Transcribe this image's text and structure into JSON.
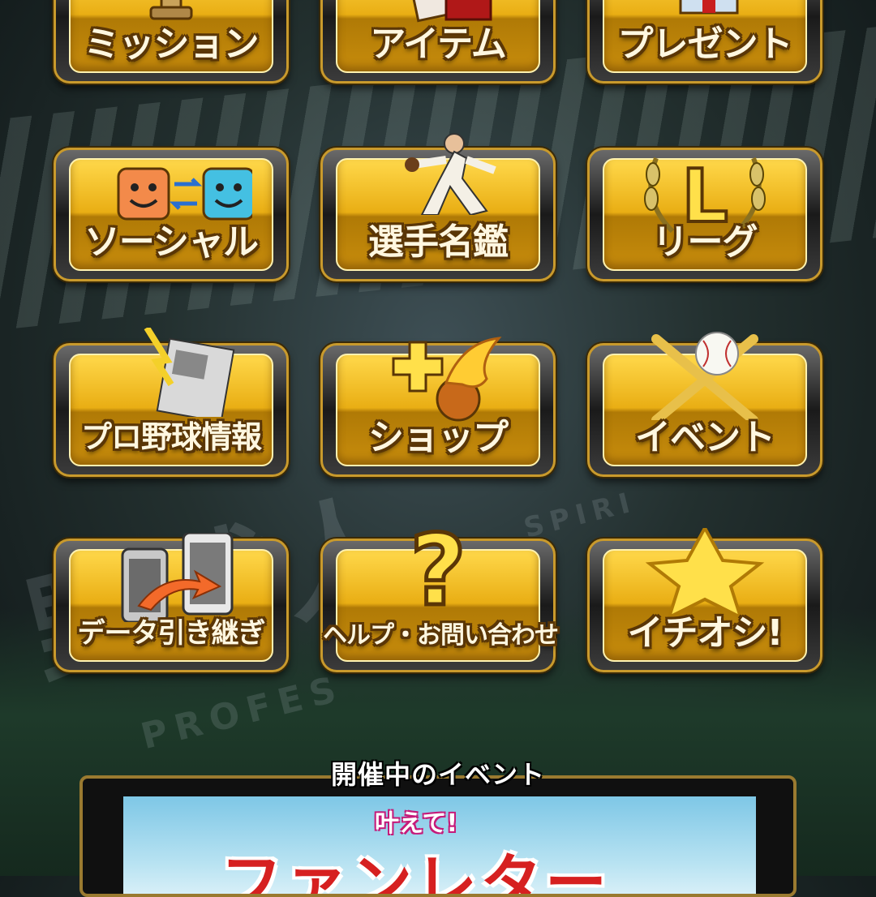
{
  "menu": {
    "items": [
      {
        "label": "ミッション"
      },
      {
        "label": "アイテム"
      },
      {
        "label": "プレゼント"
      },
      {
        "label": "ソーシャル"
      },
      {
        "label": "選手名鑑"
      },
      {
        "label": "リーグ"
      },
      {
        "label": "プロ野球情報"
      },
      {
        "label": "ショップ"
      },
      {
        "label": "イベント"
      },
      {
        "label": "データ引き継ぎ"
      },
      {
        "label": "ヘルプ・お問い合わせ"
      },
      {
        "label": "イチオシ!"
      }
    ]
  },
  "background": {
    "title": "野球人",
    "subtitle": "PROFES",
    "subtitle2": "SPIRI"
  },
  "event": {
    "heading": "開催中のイベント",
    "banner_subtitle": "叶えて!",
    "banner_title": "ファンレター"
  },
  "colors": {
    "button_gold": "#e9ae14",
    "button_border": "#c99a2c",
    "label_outline": "#5a3606"
  },
  "icons": {
    "league_letter": "L"
  }
}
